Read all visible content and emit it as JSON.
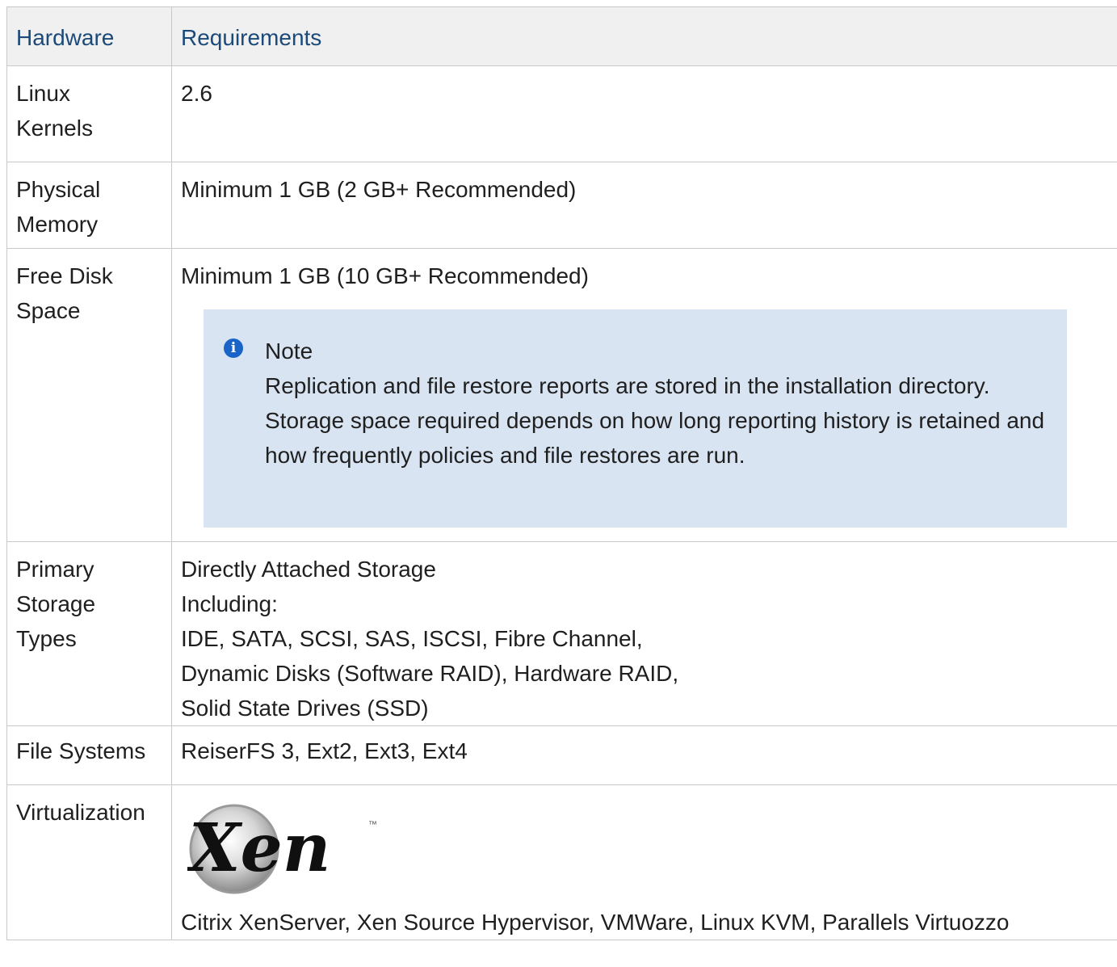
{
  "table": {
    "headers": [
      "Hardware",
      "Requirements"
    ],
    "rows": {
      "kernel": {
        "label": [
          "Linux",
          "Kernels"
        ],
        "value": "2.6"
      },
      "memory": {
        "label": [
          "Physical",
          "Memory"
        ],
        "value": "Minimum 1 GB (2 GB+ Recommended)"
      },
      "disk": {
        "label": [
          "Free Disk",
          "Space"
        ],
        "value": "Minimum 1 GB (10 GB+ Recommended)",
        "note": {
          "icon": "info-icon",
          "title": "Note",
          "body": "Replication and file restore reports are stored in the installation directory. Storage space required depends on how long reporting history is retained and how frequently policies and file restores are run."
        }
      },
      "storage": {
        "label": [
          "Primary",
          "Storage",
          "Types"
        ],
        "value_lines": [
          "Directly Attached Storage",
          "Including:",
          "IDE, SATA, SCSI, SAS, ISCSI, Fibre Channel,",
          "Dynamic Disks (Software RAID), Hardware RAID,",
          "Solid State Drives (SSD)"
        ]
      },
      "fs": {
        "label": "File Systems",
        "value": "ReiserFS 3, Ext2, Ext3, Ext4"
      },
      "virt": {
        "label": "Virtualization",
        "logo": {
          "text": "Xen",
          "trademark": "™"
        },
        "value": "Citrix XenServer, Xen Source Hypervisor, VMWare, Linux KVM, Parallels Virtuozzo"
      }
    }
  },
  "colors": {
    "header_bg": "#f0f0f0",
    "header_text": "#1b4a7a",
    "border": "#c8c8c8",
    "note_bg": "#d9e4f2",
    "info_icon": "#1a64c8"
  }
}
